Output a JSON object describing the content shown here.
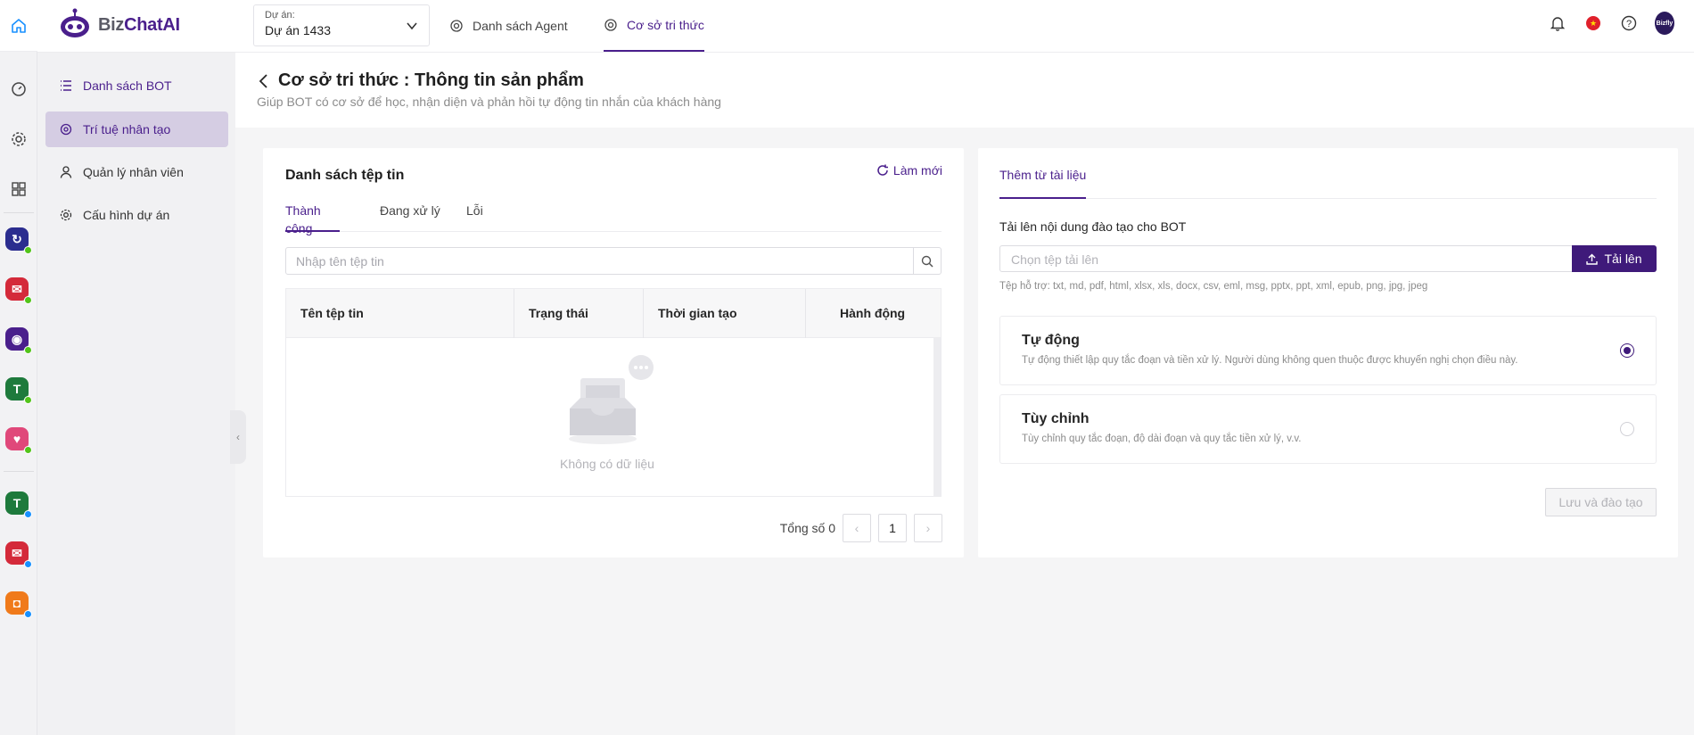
{
  "brand": {
    "name_a": "Biz",
    "name_b": "ChatAI"
  },
  "project": {
    "label": "Dự án:",
    "value": "Dự án 1433"
  },
  "nav": {
    "agents": "Danh sách Agent",
    "knowledge": "Cơ sở tri thức"
  },
  "avatar_text": "Bizfly",
  "flag_text": "★",
  "sidebar": {
    "items": [
      {
        "label": "Danh sách BOT"
      },
      {
        "label": "Trí tuệ nhân tạo"
      },
      {
        "label": "Quản lý nhân viên"
      },
      {
        "label": "Cấu hình dự án"
      }
    ]
  },
  "page": {
    "title": "Cơ sở tri thức : Thông tin sản phẩm",
    "subtitle": "Giúp BOT có cơ sở để học, nhận diện và phản hồi tự động tin nhắn của khách hàng"
  },
  "files": {
    "title": "Danh sách tệp tin",
    "refresh": "Làm mới",
    "tabs": [
      "Thành công",
      "Đang xử lý",
      "Lỗi"
    ],
    "search_placeholder": "Nhập tên tệp tin",
    "columns": [
      "Tên tệp tin",
      "Trạng thái",
      "Thời gian tạo",
      "Hành động"
    ],
    "empty": "Không có dữ liệu",
    "total": "Tổng số 0",
    "page": "1"
  },
  "upload": {
    "tab": "Thêm từ tài liệu",
    "label": "Tải lên nội dung đào tạo cho BOT",
    "placeholder": "Chọn tệp tải lên",
    "button": "Tải lên",
    "hint": "Tệp hỗ trợ: txt, md, pdf, html, xlsx, xls, docx, csv, eml, msg, pptx, ppt, xml, epub, png, jpg, jpeg",
    "options": [
      {
        "title": "Tự động",
        "desc": "Tự động thiết lập quy tắc đoạn và tiền xử lý. Người dùng không quen thuộc được khuyến nghị chọn điều này.",
        "selected": true
      },
      {
        "title": "Tùy chỉnh",
        "desc": "Tùy chỉnh quy tắc đoạn, độ dài đoạn và quy tắc tiền xử lý, v.v.",
        "selected": false
      }
    ],
    "save": "Lưu và đào tạo"
  },
  "colors": {
    "accent": "#4a1f8c",
    "button": "#3f1a7a"
  }
}
